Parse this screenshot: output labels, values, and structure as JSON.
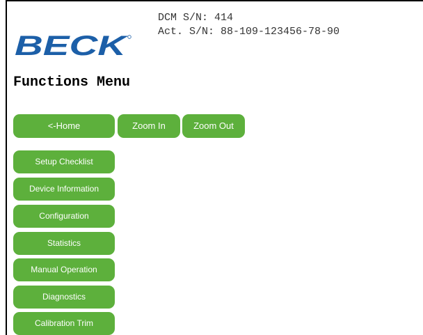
{
  "header": {
    "logo_text": "BECK",
    "dcm_serial": "DCM S/N: 414",
    "act_serial": "Act. S/N: 88-109-123456-78-90"
  },
  "page": {
    "title": "Functions Menu"
  },
  "toolbar": {
    "home_label": "<-Home",
    "zoom_in_label": "Zoom In",
    "zoom_out_label": "Zoom Out"
  },
  "menu": {
    "items": [
      {
        "label": "Setup Checklist"
      },
      {
        "label": "Device Information"
      },
      {
        "label": "Configuration"
      },
      {
        "label": "Statistics"
      },
      {
        "label": "Manual Operation"
      },
      {
        "label": "Diagnostics"
      },
      {
        "label": "Calibration Trim"
      }
    ]
  },
  "colors": {
    "button_green": "#5db03c",
    "logo_blue": "#1c5fa8"
  }
}
